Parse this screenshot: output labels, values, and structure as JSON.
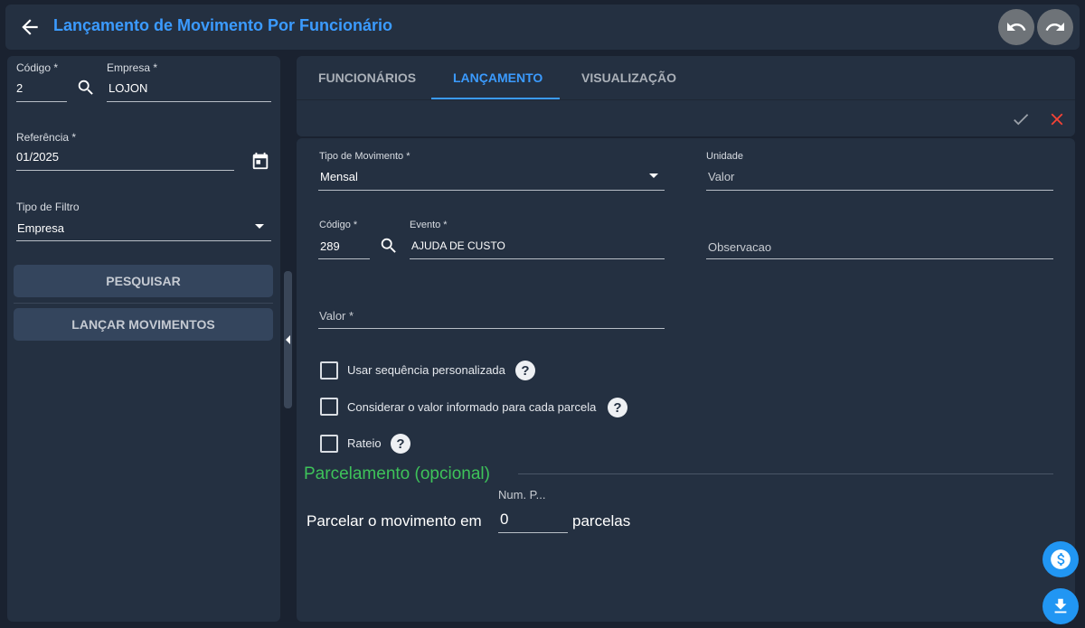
{
  "header": {
    "title": "Lançamento de Movimento Por Funcionário"
  },
  "left": {
    "codigo": {
      "label": "Código *",
      "value": "2"
    },
    "empresa": {
      "label": "Empresa *",
      "value": "LOJON"
    },
    "referencia": {
      "label": "Referência *",
      "value": "01/2025"
    },
    "tipo_filtro": {
      "label": "Tipo de Filtro",
      "value": "Empresa"
    },
    "search_button": "PESQUISAR",
    "launch_button": "LANÇAR MOVIMENTOS"
  },
  "tabs": [
    {
      "label": "FUNCIONÁRIOS"
    },
    {
      "label": "LANÇAMENTO"
    },
    {
      "label": "VISUALIZAÇÃO"
    }
  ],
  "active_tab": "LANÇAMENTO",
  "form": {
    "tipo_movimento": {
      "label": "Tipo de Movimento *",
      "value": "Mensal"
    },
    "unidade": {
      "label": "Unidade",
      "placeholder": "Valor"
    },
    "codigo": {
      "label": "Código *",
      "value": "289"
    },
    "evento": {
      "label": "Evento *",
      "value": "AJUDA DE CUSTO"
    },
    "observacao": {
      "placeholder": "Observacao"
    },
    "valor": {
      "placeholder": "Valor *"
    },
    "checkboxes": [
      {
        "label": "Usar sequência personalizada",
        "checked": false
      },
      {
        "label": "Considerar o valor informado para cada parcela",
        "checked": false
      },
      {
        "label": "Rateio",
        "checked": false
      }
    ]
  },
  "parcelamento": {
    "title": "Parcelamento (opcional)",
    "field_label": "Num. P...",
    "prefix": "Parcelar o movimento em",
    "value": "0",
    "suffix": "parcelas"
  },
  "colors": {
    "accent": "#3b9bff",
    "green": "#3ec35a",
    "danger": "#f44336",
    "fab": "#2196f3"
  },
  "icons": [
    "arrow-left-icon",
    "undo-icon",
    "redo-icon",
    "search-icon",
    "calendar-icon",
    "dropdown-arrow-icon",
    "check-icon",
    "close-icon",
    "help-icon",
    "dollar-icon",
    "download-icon",
    "collapse-icon"
  ]
}
